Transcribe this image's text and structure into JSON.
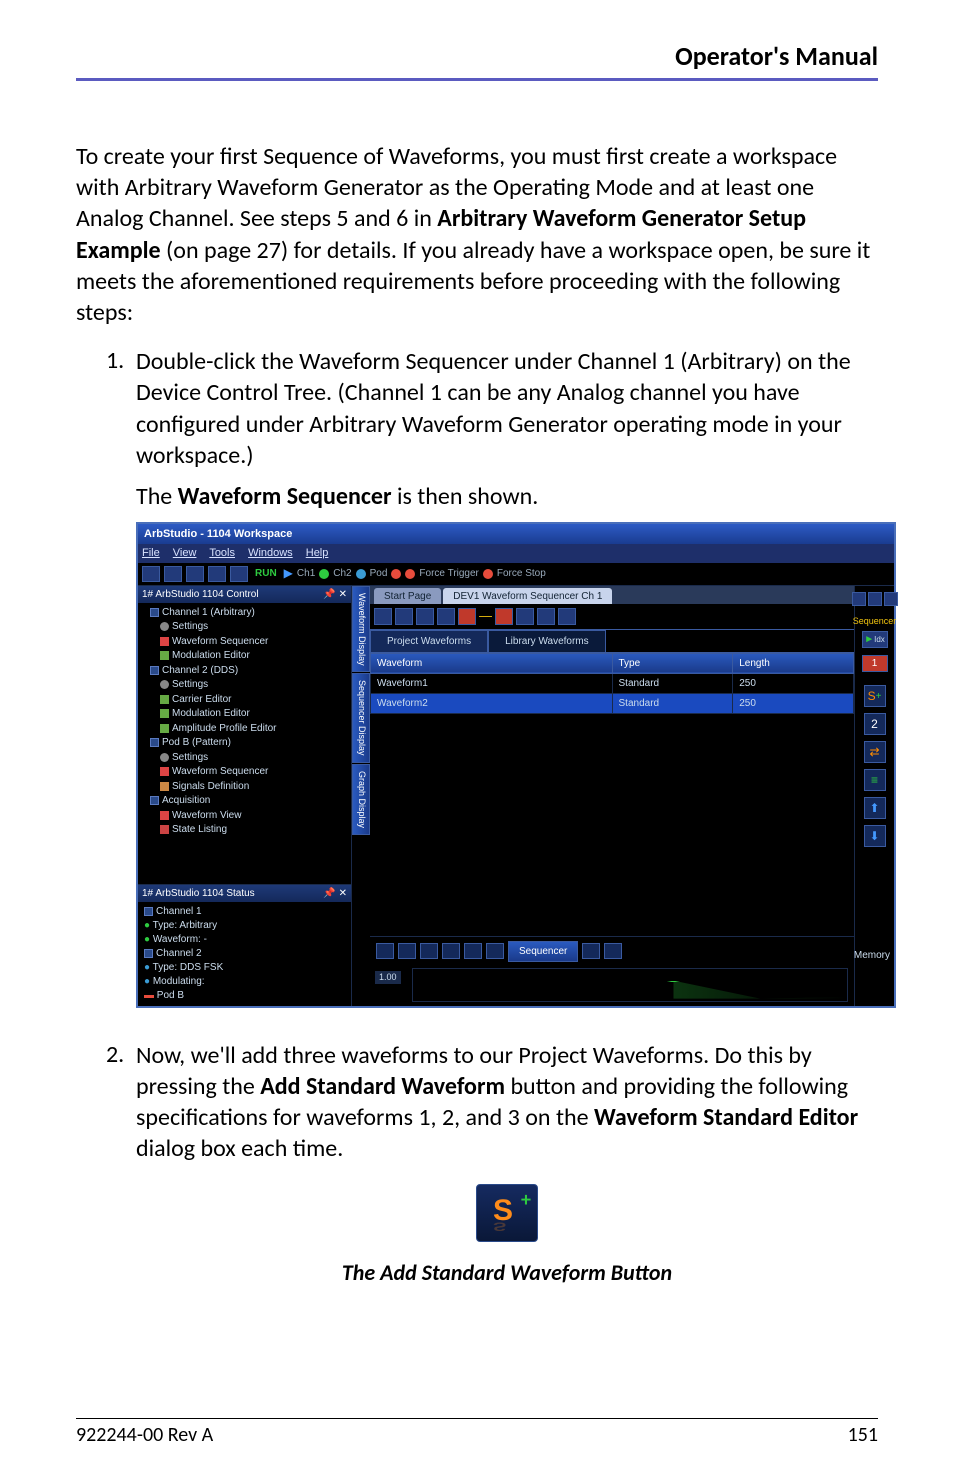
{
  "header": {
    "title": "Operator's Manual"
  },
  "intro": {
    "p1_a": "To create your first Sequence of Waveforms, you must first create a workspace with Arbitrary Waveform Generator as the Operating Mode and at least one Analog Channel. See steps 5 and 6 in ",
    "p1_bold": "Arbitrary Waveform Generator Setup Example",
    "p1_b": " (on page 27) for details. If you already have a workspace open, be sure it meets the aforementioned requirements before proceeding with the following steps:"
  },
  "steps": {
    "s1": {
      "num": "1.",
      "text": "Double-click the Waveform Sequencer under Channel 1 (Arbitrary) on the Device Control Tree. (Channel 1 can be any Analog channel you have configured under Arbitrary Waveform Generator operating mode in your workspace.)",
      "result_a": "The ",
      "result_bold": "Waveform Sequencer",
      "result_b": " is then shown."
    },
    "s2": {
      "num": "2.",
      "a": "Now, we'll add three waveforms to our Project Waveforms. Do this by pressing the ",
      "bold1": "Add Standard Waveform",
      "b": " button and providing the following specifications for waveforms 1, 2, and 3 on the ",
      "bold2": "Waveform Standard Editor",
      "c": " dialog box each time."
    }
  },
  "app": {
    "title": "ArbStudio - 1104 Workspace",
    "menu": {
      "file": "File",
      "view": "View",
      "tools": "Tools",
      "windows": "Windows",
      "help": "Help"
    },
    "toolbar": {
      "run": "RUN",
      "ch1": "Ch1",
      "ch2": "Ch2",
      "pod": "Pod",
      "ft": "Force Trigger",
      "fs": "Force Stop"
    },
    "control_panel": {
      "title": "1# ArbStudio 1104 Control",
      "pin": "📌 ✕"
    },
    "tree": {
      "ch1": "Channel 1 (Arbitrary)",
      "settings": "Settings",
      "wseq": "Waveform Sequencer",
      "modedit": "Modulation Editor",
      "ch2": "Channel 2 (DDS)",
      "carrier": "Carrier Editor",
      "modedit2": "Modulation Editor",
      "ampedit": "Amplitude Profile Editor",
      "podb": "Pod B (Pattern)",
      "sigdef": "Signals Definition",
      "acq": "Acquisition",
      "wview": "Waveform View",
      "state": "State Listing"
    },
    "status_panel": {
      "title": "1# ArbStudio 1104 Status",
      "pin": "📌 ✕"
    },
    "status": {
      "ch1": "Channel 1",
      "type1": "Type: Arbitrary",
      "wf": "Waveform: -",
      "ch2": "Channel 2",
      "type2": "Type: DDS FSK",
      "mod": "Modulating:",
      "podb": "Pod B"
    },
    "side_tabs": {
      "wd": "Waveform Display",
      "sd": "Sequencer Display",
      "gd": "Graph Display"
    },
    "page_tabs": {
      "start": "Start Page",
      "dev": "DEV1 Waveform Sequencer Ch 1"
    },
    "inner_tabs": {
      "pw": "Project Waveforms",
      "lw": "Library Waveforms"
    },
    "table": {
      "h1": "Waveform",
      "h2": "Type",
      "h3": "Length",
      "r1": {
        "n": "Waveform1",
        "t": "Standard",
        "l": "250"
      },
      "r2": {
        "n": "Waveform2",
        "t": "Standard",
        "l": "250"
      }
    },
    "right": {
      "seq": "Sequencer",
      "idx": "Idx",
      "one": "1",
      "two": "2"
    },
    "bottom": {
      "seq": "Sequencer",
      "val": "1.00",
      "mem": "Memory"
    }
  },
  "caption": "The Add Standard Waveform Button",
  "footer": {
    "left": "922244-00 Rev A",
    "right": "151"
  }
}
